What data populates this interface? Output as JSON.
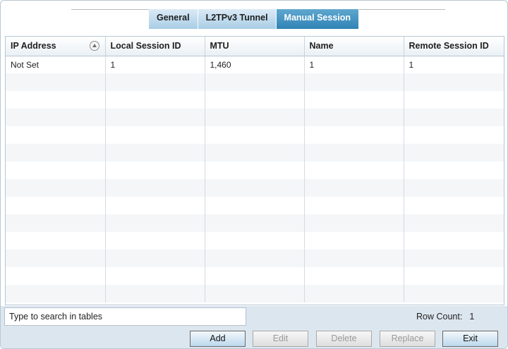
{
  "tabs": [
    {
      "label": "General",
      "active": false
    },
    {
      "label": "L2TPv3 Tunnel",
      "active": false
    },
    {
      "label": "Manual Session",
      "active": true
    }
  ],
  "table": {
    "columns": [
      "IP Address",
      "Local Session ID",
      "MTU",
      "Name",
      "Remote Session ID"
    ],
    "rows": [
      [
        "Not Set",
        "1",
        "1,460",
        "1",
        "1"
      ]
    ]
  },
  "search": {
    "placeholder": "Type to search in tables"
  },
  "row_count": {
    "label": "Row Count:",
    "value": "1"
  },
  "buttons": {
    "add": "Add",
    "edit": "Edit",
    "delete": "Delete",
    "replace": "Replace",
    "exit": "Exit"
  },
  "colors": {
    "active_tab": "#3a8cbd",
    "inactive_tab": "#b8d7ec",
    "bottom_bar": "#dce6ef"
  }
}
